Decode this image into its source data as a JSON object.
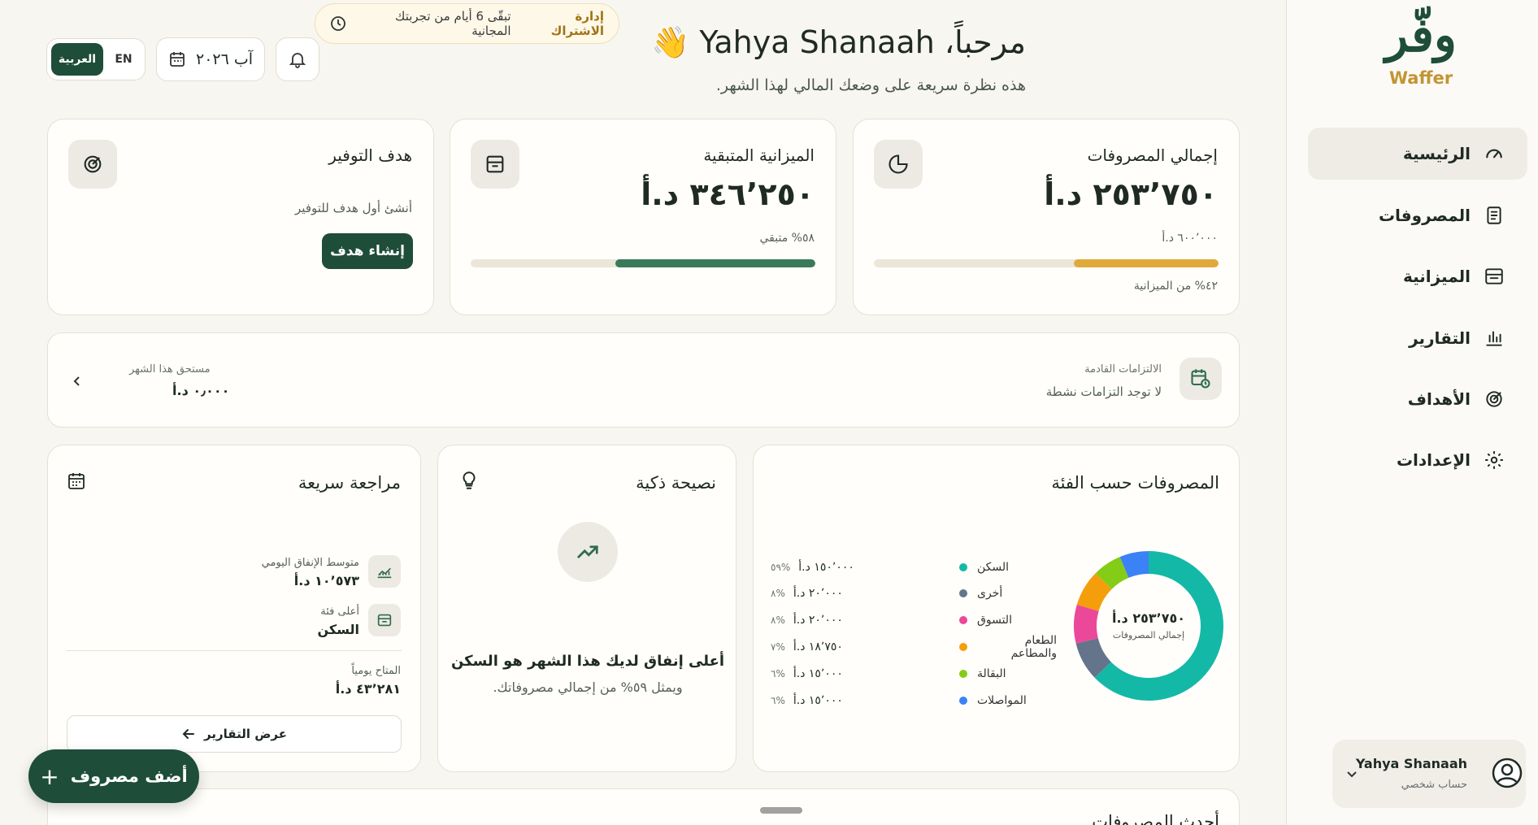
{
  "sidebar": {
    "logo_ar": "وفّر",
    "logo_en": "Waffer",
    "items": [
      {
        "label": "الرئيسية"
      },
      {
        "label": "المصروفات"
      },
      {
        "label": "الميزانية"
      },
      {
        "label": "التقارير"
      },
      {
        "label": "الأهداف"
      },
      {
        "label": "الإعدادات"
      }
    ],
    "profile": {
      "name": "Yahya Shanaah",
      "role": "حساب شخصي"
    }
  },
  "header": {
    "greeting": "مرحباً، Yahya Shanaah",
    "wave": "👋",
    "subtitle": "هذه نظرة سريعة على وضعك المالي لهذا الشهر.",
    "trial_text": "تبقّى 6 أيام من تجربتك المجانية",
    "trial_link": "إدارة الاشتراك",
    "month": "آب ٢٠٢٦",
    "lang_ar": "العربية",
    "lang_en": "EN"
  },
  "stats": {
    "expenses": {
      "title": "إجمالي المصروفات",
      "value": "٢٥٣٬٧٥٠ د.أ",
      "budget": "٦٠٠٬٠٠٠ د.أ",
      "note": "٤٢% من الميزانية",
      "fill": 0.42,
      "color": "#e0a93b"
    },
    "remaining": {
      "title": "الميزانية المتبقية",
      "value": "٣٤٦٬٢٥٠ د.أ",
      "note": "٥٨% متبقي",
      "fill": 0.58,
      "color": "#3a7a5a"
    },
    "goal": {
      "title": "هدف التوفير",
      "empty": "أنشئ أول هدف للتوفير",
      "button": "إنشاء هدف"
    }
  },
  "commitments": {
    "title": "الالتزامات القادمة",
    "empty": "لا توجد التزامات نشطة",
    "due_label": "مستحق هذا الشهر",
    "due_value": "٠٫٠٠٠ د.أ"
  },
  "category_card": {
    "title": "المصروفات حسب الفئة",
    "center_value": "٢٥٣٬٧٥٠ د.أ",
    "center_label": "إجمالي المصروفات"
  },
  "chart_data": {
    "type": "pie",
    "categories": [
      "السكن",
      "أخرى",
      "التسوق",
      "الطعام والمطاعم",
      "البقالة",
      "المواصلات"
    ],
    "values": [
      150000,
      20000,
      20000,
      18750,
      15000,
      15000
    ],
    "labels": [
      "١٥٠٬٠٠٠ د.أ",
      "٢٠٬٠٠٠ د.أ",
      "٢٠٬٠٠٠ د.أ",
      "١٨٬٧٥٠ د.أ",
      "١٥٬٠٠٠ د.أ",
      "١٥٬٠٠٠ د.أ"
    ],
    "percents": [
      "٥٩%",
      "٨%",
      "٨%",
      "٧%",
      "٦%",
      "٦%"
    ],
    "colors": [
      "#14b8a6",
      "#64748b",
      "#ec4899",
      "#f59e0b",
      "#84cc16",
      "#3b82f6"
    ]
  },
  "tip_card": {
    "title": "نصيحة ذكية",
    "headline": "أعلى إنفاق لديك هذا الشهر هو السكن",
    "body": "ويمثل ٥٩% من إجمالي مصروفاتك."
  },
  "review_card": {
    "title": "مراجعة سريعة",
    "daily_label": "متوسط الإنفاق اليومي",
    "daily_value": "١٠٬٥٧٣ د.أ",
    "top_label": "أعلى فئة",
    "top_value": "السكن",
    "avail_label": "المتاح يومياً",
    "avail_value": "٤٣٬٢٨١ د.أ",
    "reports_button": "عرض التقارير"
  },
  "recent_title": "أحدث المصروفات",
  "fab_label": "أضف مصروف"
}
